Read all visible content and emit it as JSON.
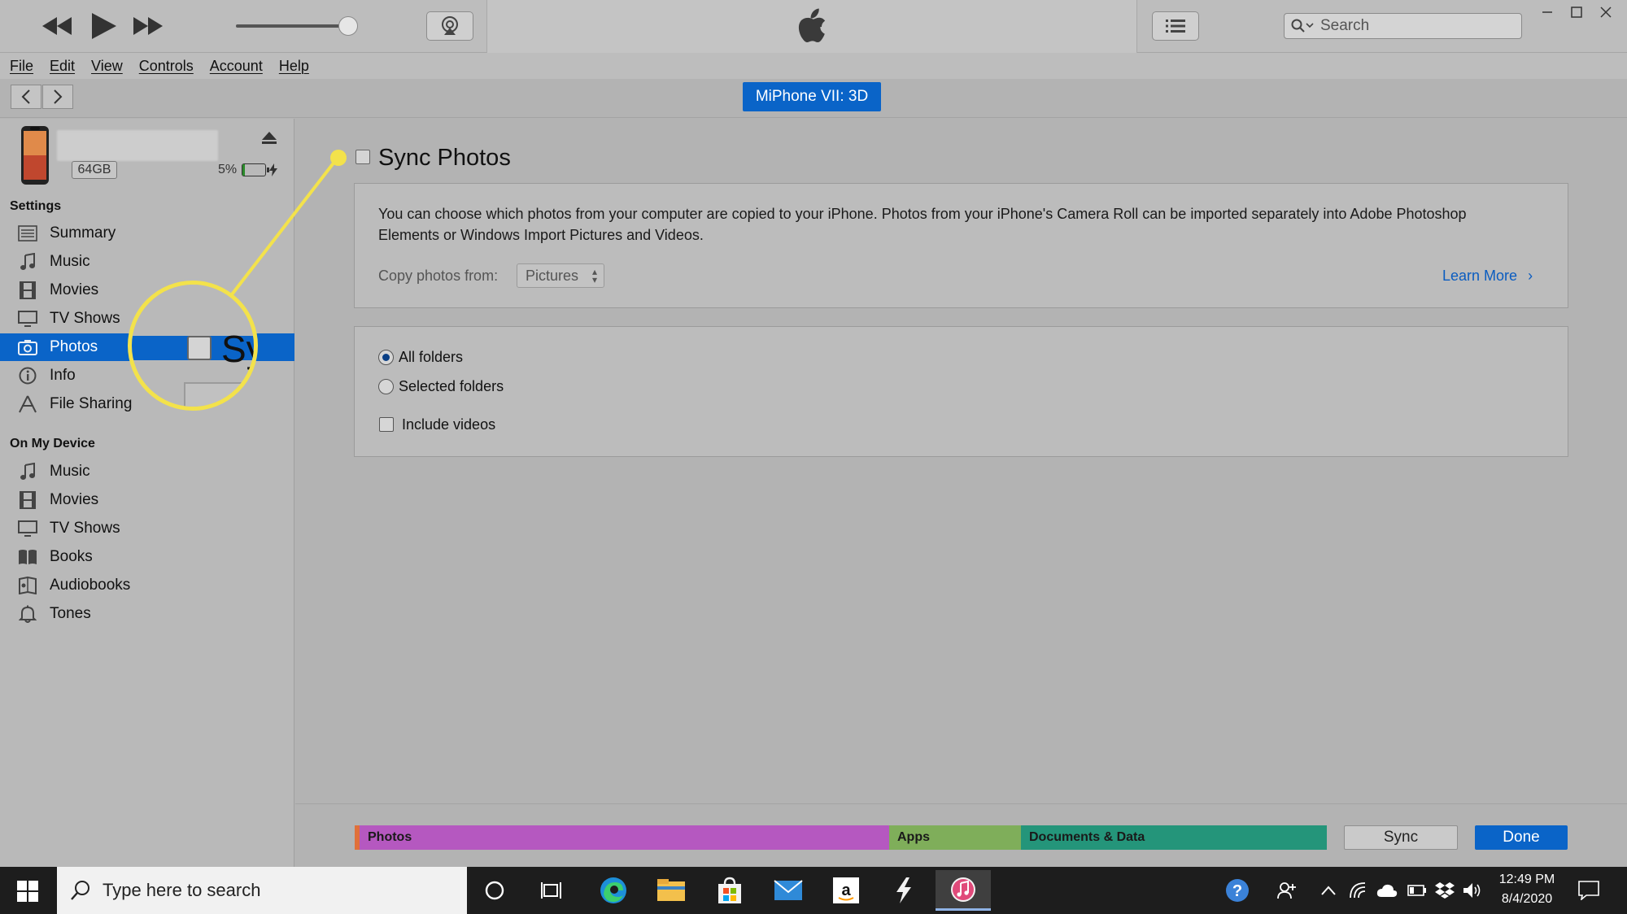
{
  "topbar": {
    "search_placeholder": "Search"
  },
  "menu": [
    "File",
    "Edit",
    "View",
    "Controls",
    "Account",
    "Help"
  ],
  "device": {
    "pill_label": "MiPhone VII: 3D",
    "capacity": "64GB",
    "battery": "5%"
  },
  "sidebar": {
    "settings_header": "Settings",
    "settings_items": [
      {
        "label": "Summary",
        "icon": "summary-icon"
      },
      {
        "label": "Music",
        "icon": "music-note-icon"
      },
      {
        "label": "Movies",
        "icon": "film-icon"
      },
      {
        "label": "TV Shows",
        "icon": "tv-icon"
      },
      {
        "label": "Photos",
        "icon": "camera-icon"
      },
      {
        "label": "Info",
        "icon": "info-icon"
      },
      {
        "label": "File Sharing",
        "icon": "file-sharing-icon"
      }
    ],
    "device_header": "On My Device",
    "device_items": [
      {
        "label": "Music",
        "icon": "music-note-icon"
      },
      {
        "label": "Movies",
        "icon": "film-icon"
      },
      {
        "label": "TV Shows",
        "icon": "tv-icon"
      },
      {
        "label": "Books",
        "icon": "book-icon"
      },
      {
        "label": "Audiobooks",
        "icon": "audiobook-icon"
      },
      {
        "label": "Tones",
        "icon": "bell-icon"
      }
    ]
  },
  "main": {
    "sync_title": "Sync Photos",
    "sync_checked": false,
    "description": "You can choose which photos from your computer are copied to your iPhone. Photos from your iPhone's Camera Roll can be imported separately into Adobe Photoshop Elements or Windows Import Pictures and Videos.",
    "copy_from_label": "Copy photos from:",
    "copy_from_value": "Pictures",
    "learn_more": "Learn More",
    "options": {
      "all_folders": "All folders",
      "selected_folders": "Selected folders",
      "include_videos": "Include videos",
      "selected": "all_folders"
    }
  },
  "callout": {
    "magnified_text": "Sy"
  },
  "capacity_bar": {
    "segments": [
      {
        "label": "Photos",
        "color": "#b558c0"
      },
      {
        "label": "Apps",
        "color": "#7fae5a"
      },
      {
        "label": "Documents & Data",
        "color": "#24957a"
      }
    ]
  },
  "footer": {
    "sync_button": "Sync",
    "done_button": "Done"
  },
  "taskbar": {
    "search_placeholder": "Type here to search",
    "time": "12:49 PM",
    "date": "8/4/2020"
  },
  "colors": {
    "accent": "#0a64c8",
    "callout": "#f3e24b"
  }
}
